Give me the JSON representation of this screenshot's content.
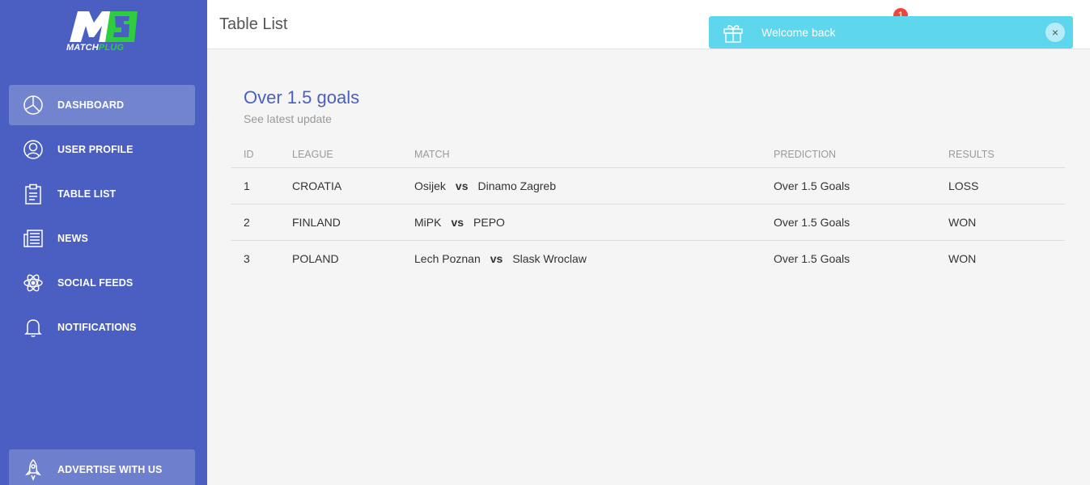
{
  "brand": {
    "logo_letter": "M",
    "name_main": "MATCH",
    "name_accent": "PLUG",
    "accent_color": "#2ecc40"
  },
  "sidebar": {
    "bg_color": "#4a5fc1",
    "items": [
      {
        "label": "DASHBOARD",
        "icon": "pie-chart-icon",
        "active": true
      },
      {
        "label": "USER PROFILE",
        "icon": "user-icon",
        "active": false
      },
      {
        "label": "TABLE LIST",
        "icon": "clipboard-icon",
        "active": false
      },
      {
        "label": "NEWS",
        "icon": "newspaper-icon",
        "active": false
      },
      {
        "label": "SOCIAL FEEDS",
        "icon": "atom-icon",
        "active": false
      },
      {
        "label": "NOTIFICATIONS",
        "icon": "bell-icon",
        "active": false
      }
    ],
    "bottom_item": {
      "label": "ADVERTISE WITH US",
      "icon": "rocket-icon"
    }
  },
  "header": {
    "title": "Table List",
    "notification_count": "1"
  },
  "toast": {
    "message": "Welcome back",
    "icon": "gift-icon",
    "close": "×",
    "color": "#5ed6ed"
  },
  "card": {
    "title": "Over 1.5 goals",
    "subtitle": "See latest update",
    "title_color": "#4a5fc1"
  },
  "table": {
    "headers": [
      "ID",
      "LEAGUE",
      "MATCH",
      "PREDICTION",
      "RESULTS"
    ],
    "vs_label": "vs",
    "rows": [
      {
        "id": "1",
        "league": "CROATIA",
        "home": "Osijek",
        "away": "Dinamo Zagreb",
        "prediction": "Over 1.5 Goals",
        "result": "LOSS"
      },
      {
        "id": "2",
        "league": "FINLAND",
        "home": "MiPK",
        "away": "PEPO",
        "prediction": "Over 1.5 Goals",
        "result": "WON"
      },
      {
        "id": "3",
        "league": "POLAND",
        "home": "Lech Poznan",
        "away": "Slask Wroclaw",
        "prediction": "Over 1.5 Goals",
        "result": "WON"
      }
    ]
  }
}
